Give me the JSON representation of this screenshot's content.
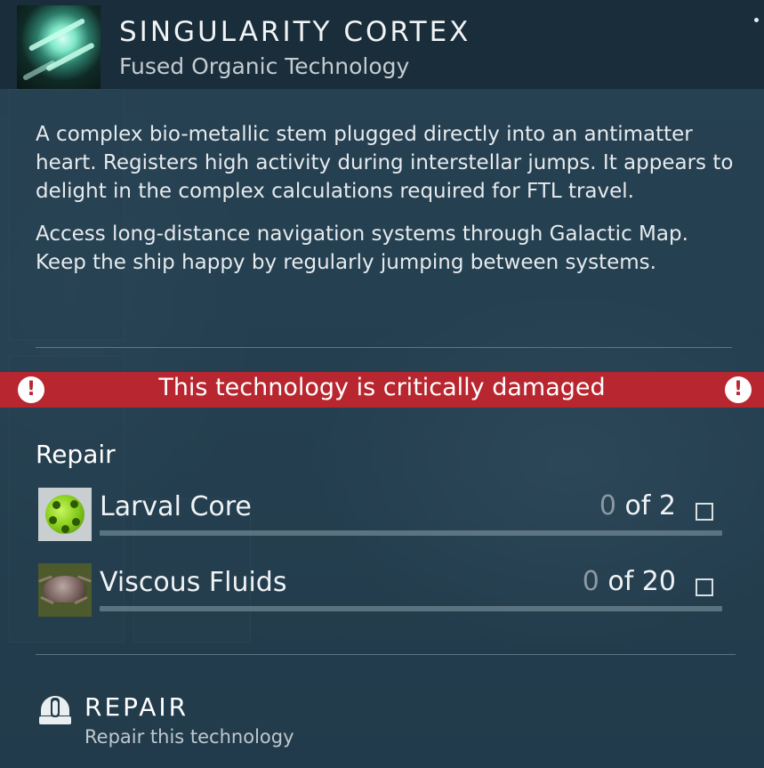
{
  "header": {
    "title": "SINGULARITY CORTEX",
    "subtitle": "Fused Organic Technology",
    "item_icon": "singularity-cortex-icon"
  },
  "description": {
    "paragraph_1": "A complex bio-metallic stem plugged directly into an antimatter heart. Registers high activity during interstellar jumps. It appears to delight in the complex calculations required for FTL travel.",
    "paragraph_2": "Access long-distance navigation systems through Galactic Map. Keep the ship happy by regularly jumping between systems."
  },
  "warning": {
    "text": "This technology is critically damaged",
    "icon_symbol": "!",
    "color": "#b8262f"
  },
  "repair": {
    "heading": "Repair",
    "requirements": [
      {
        "name": "Larval Core",
        "have": "0",
        "of_label": "of 2",
        "progress": 0,
        "icon": "larval-core-icon"
      },
      {
        "name": "Viscous Fluids",
        "have": "0",
        "of_label": "of 20",
        "progress": 0,
        "icon": "viscous-fluids-icon"
      }
    ]
  },
  "action": {
    "label": "REPAIR",
    "sublabel": "Repair this technology",
    "icon": "repair-hold-icon"
  }
}
